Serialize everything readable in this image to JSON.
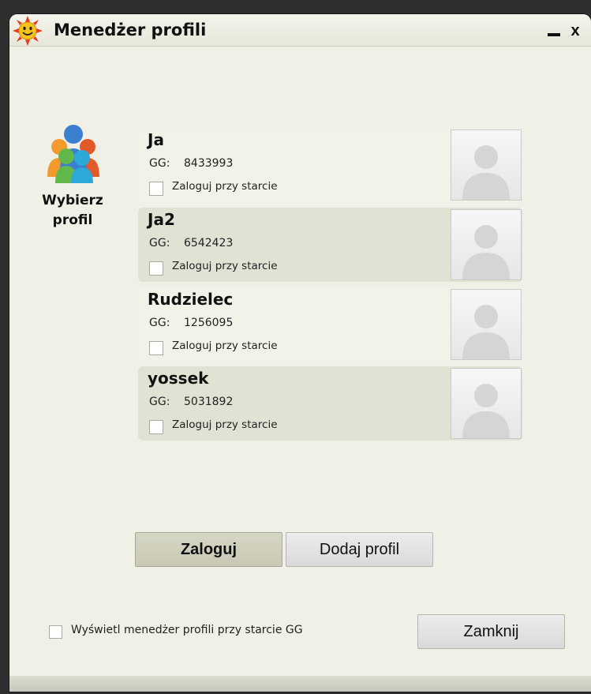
{
  "window": {
    "title": "Menedżer profili",
    "minimize_label": "_",
    "close_label": "x"
  },
  "sidebar": {
    "label_line1": "Wybierz",
    "label_line2": "profil"
  },
  "profiles": [
    {
      "name": "Ja",
      "gg_label": "GG:",
      "gg_number": "8433993",
      "autologin_label": "Zaloguj przy starcie",
      "autologin_checked": false
    },
    {
      "name": "Ja2",
      "gg_label": "GG:",
      "gg_number": "6542423",
      "autologin_label": "Zaloguj przy starcie",
      "autologin_checked": false
    },
    {
      "name": "Rudzielec",
      "gg_label": "GG:",
      "gg_number": "1256095",
      "autologin_label": "Zaloguj przy starcie",
      "autologin_checked": false
    },
    {
      "name": "yossek",
      "gg_label": "GG:",
      "gg_number": "5031892",
      "autologin_label": "Zaloguj przy starcie",
      "autologin_checked": false
    }
  ],
  "actions": {
    "login_label": "Zaloguj",
    "add_profile_label": "Dodaj profil",
    "close_label": "Zamknij"
  },
  "footer": {
    "show_manager_label": "Wyświetl menedżer profili przy starcie GG",
    "show_manager_checked": false
  },
  "colors": {
    "selected_row": "#e1e1d4",
    "window_bg": "#f0f0e6"
  }
}
